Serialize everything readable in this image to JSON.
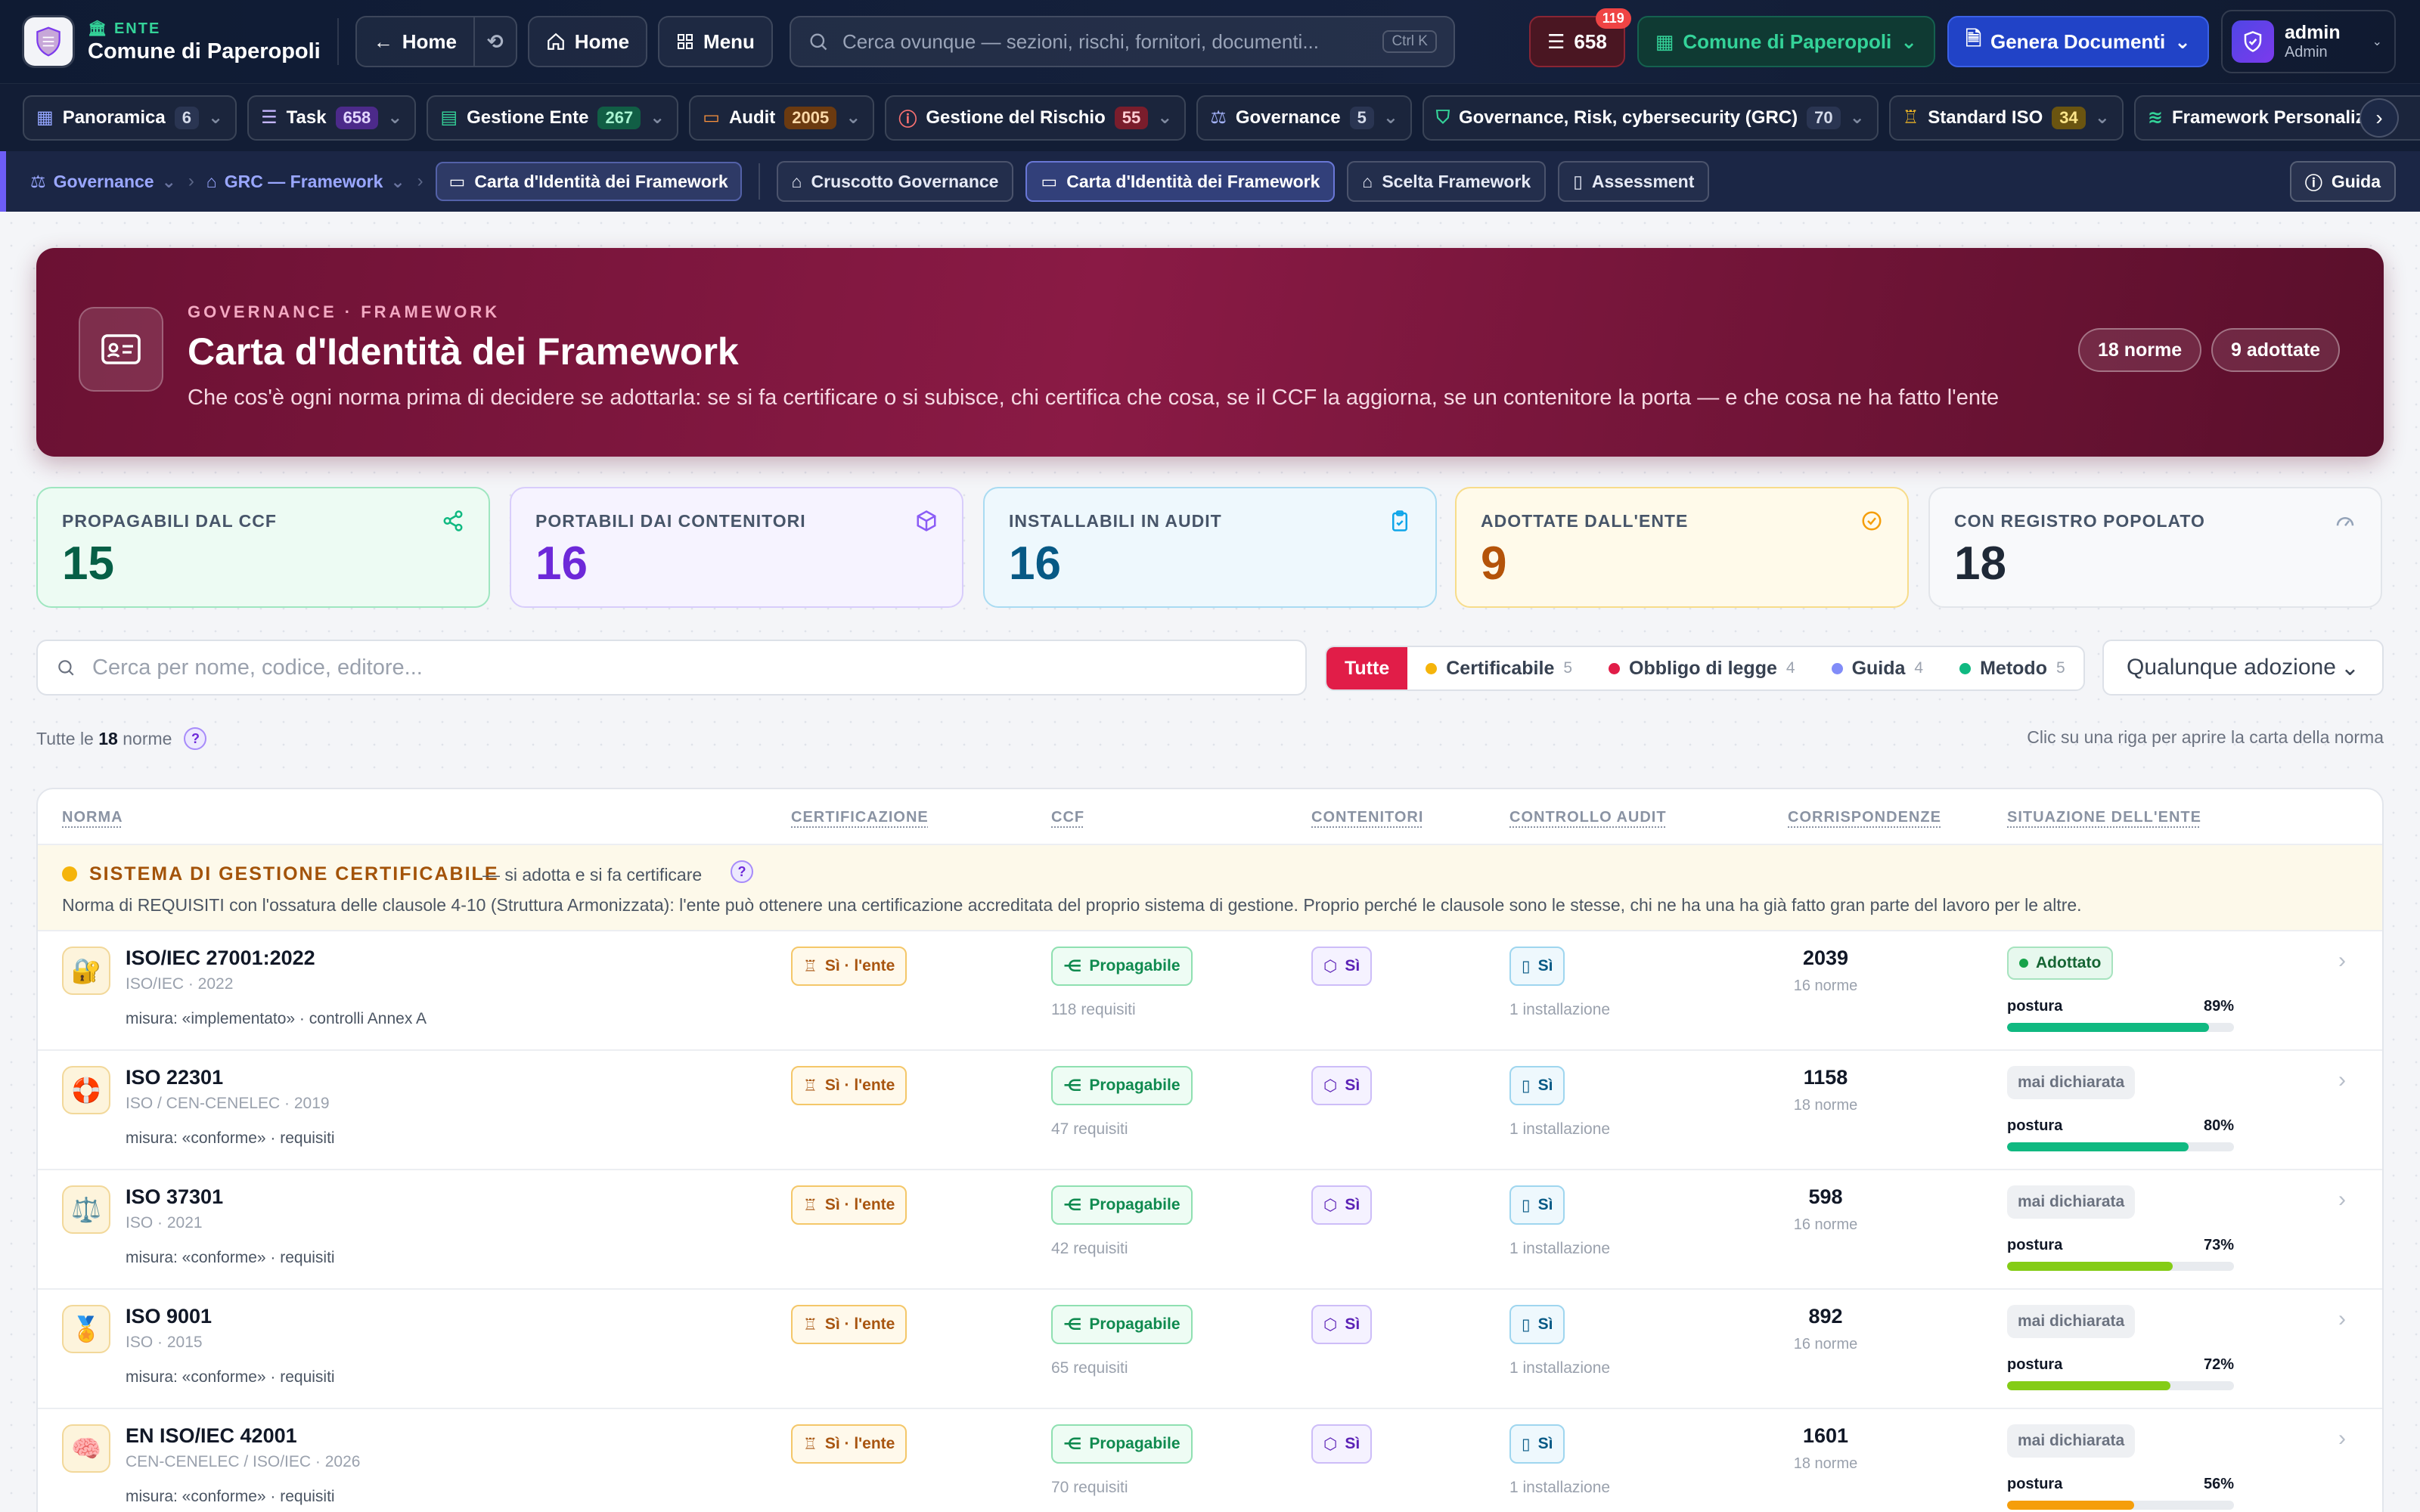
{
  "topbar": {
    "ente_tag": "ENTE",
    "ente_name": "Comune di Paperopoli",
    "back_label": "Home",
    "home_label": "Home",
    "menu_label": "Menu",
    "search_placeholder": "Cerca ovunque — sezioni, rischi, fornitori, documenti...",
    "search_shortcut": "Ctrl K",
    "task_count": "658",
    "task_notifications": "119",
    "ente_select": "Comune di Paperopoli",
    "generate_label": "Genera Documenti",
    "user_name": "admin",
    "user_role": "Admin"
  },
  "modules": [
    {
      "label": "Panoramica",
      "count": "6",
      "icon": "grid-icon"
    },
    {
      "label": "Task",
      "count": "658",
      "icon": "checklist-icon"
    },
    {
      "label": "Gestione Ente",
      "count": "267",
      "icon": "building-icon"
    },
    {
      "label": "Audit",
      "count": "2005",
      "icon": "folder-icon"
    },
    {
      "label": "Gestione del Rischio",
      "count": "55",
      "icon": "alert-icon"
    },
    {
      "label": "Governance",
      "count": "5",
      "icon": "scale-icon"
    },
    {
      "label": "Governance, Risk, cybersecurity (GRC)",
      "count": "70",
      "icon": "shield-icon"
    },
    {
      "label": "Standard ISO",
      "count": "34",
      "icon": "award-icon"
    },
    {
      "label": "Framework Personalizzati",
      "count": "",
      "icon": "layers-icon"
    }
  ],
  "breadcrumb": {
    "level1": "Governance",
    "level2": "GRC — Framework",
    "current": "Carta d'Identità dei Framework",
    "tabs": [
      "Cruscotto Governance",
      "Carta d'Identità dei Framework",
      "Scelta Framework",
      "Assessment"
    ],
    "guide_label": "Guida"
  },
  "hero": {
    "kicker": "GOVERNANCE · FRAMEWORK",
    "title": "Carta d'Identità dei Framework",
    "subtitle": "Che cos'è ogni norma prima di decidere se adottarla: se si fa certificare o si subisce, chi certifica che cosa, se il CCF la aggiorna, se un contenitore la porta — e che cosa ne ha fatto l'ente",
    "pill_norms": "18 norme",
    "pill_adopted": "9 adottate"
  },
  "stats": [
    {
      "label": "PROPAGABILI DAL CCF",
      "value": "15"
    },
    {
      "label": "PORTABILI DAI CONTENITORI",
      "value": "16"
    },
    {
      "label": "INSTALLABILI IN AUDIT",
      "value": "16"
    },
    {
      "label": "ADOTTATE DALL'ENTE",
      "value": "9"
    },
    {
      "label": "CON REGISTRO POPOLATO",
      "value": "18"
    }
  ],
  "filters": {
    "search_placeholder": "Cerca per nome, codice, editore...",
    "chips": [
      {
        "label": "Tutte",
        "count": ""
      },
      {
        "label": "Certificabile",
        "count": "5",
        "color": "#f5b40b"
      },
      {
        "label": "Obbligo di legge",
        "count": "4",
        "color": "#e11d48"
      },
      {
        "label": "Guida",
        "count": "4",
        "color": "#818cf8"
      },
      {
        "label": "Metodo",
        "count": "5",
        "color": "#10b981"
      }
    ],
    "adoption_select": "Qualunque adozione"
  },
  "summary": {
    "prefix": "Tutte le",
    "count": "18",
    "suffix": "norme",
    "hint": "Clic su una riga per aprire la carta della norma"
  },
  "table": {
    "headers": [
      "NORMA",
      "CERTIFICAZIONE",
      "CCF",
      "CONTENITORI",
      "CONTROLLO AUDIT",
      "CORRISPONDENZE",
      "SITUAZIONE DELL'ENTE"
    ],
    "group": {
      "title": "SISTEMA DI GESTIONE CERTIFICABILE",
      "tag": "— si adotta e si fa certificare",
      "description": "Norma di REQUISITI con l'ossatura delle clausole 4-10 (Struttura Armonizzata): l'ente può ottenere una certificazione accreditata del proprio sistema di gestione. Proprio perché le clausole sono le stesse, chi ne ha una ha già fatto gran parte del lavoro per le altre."
    },
    "rows": [
      {
        "icon": "🔐",
        "name": "ISO/IEC 27001:2022",
        "meta": "ISO/IEC · 2022",
        "measure": "misura: «implementato» · controlli Annex A",
        "cert": "Sì · l'ente",
        "ccf": "Propagabile",
        "ccf_sub": "118 requisiti",
        "cont": "Sì",
        "audit": "Sì",
        "audit_sub": "1 installazione",
        "corr": "2039",
        "corr_sub": "16 norme",
        "status": "Adottato",
        "posture_label": "postura",
        "posture": "89%",
        "posture_value": 89,
        "bar_color": "#10b981"
      },
      {
        "icon": "🛟",
        "name": "ISO 22301",
        "meta": "ISO / CEN-CENELEC · 2019",
        "measure": "misura: «conforme» · requisiti",
        "cert": "Sì · l'ente",
        "ccf": "Propagabile",
        "ccf_sub": "47 requisiti",
        "cont": "Sì",
        "audit": "Sì",
        "audit_sub": "1 installazione",
        "corr": "1158",
        "corr_sub": "18 norme",
        "status": "mai dichiarata",
        "posture_label": "postura",
        "posture": "80%",
        "posture_value": 80,
        "bar_color": "#10b981"
      },
      {
        "icon": "⚖️",
        "name": "ISO 37301",
        "meta": "ISO · 2021",
        "measure": "misura: «conforme» · requisiti",
        "cert": "Sì · l'ente",
        "ccf": "Propagabile",
        "ccf_sub": "42 requisiti",
        "cont": "Sì",
        "audit": "Sì",
        "audit_sub": "1 installazione",
        "corr": "598",
        "corr_sub": "16 norme",
        "status": "mai dichiarata",
        "posture_label": "postura",
        "posture": "73%",
        "posture_value": 73,
        "bar_color": "#84cc16"
      },
      {
        "icon": "🏅",
        "name": "ISO 9001",
        "meta": "ISO · 2015",
        "measure": "misura: «conforme» · requisiti",
        "cert": "Sì · l'ente",
        "ccf": "Propagabile",
        "ccf_sub": "65 requisiti",
        "cont": "Sì",
        "audit": "Sì",
        "audit_sub": "1 installazione",
        "corr": "892",
        "corr_sub": "16 norme",
        "status": "mai dichiarata",
        "posture_label": "postura",
        "posture": "72%",
        "posture_value": 72,
        "bar_color": "#84cc16"
      },
      {
        "icon": "🧠",
        "name": "EN ISO/IEC 42001",
        "meta": "CEN-CENELEC / ISO/IEC · 2026",
        "measure": "misura: «conforme» · requisiti",
        "cert": "Sì · l'ente",
        "ccf": "Propagabile",
        "ccf_sub": "70 requisiti",
        "cont": "Sì",
        "audit": "Sì",
        "audit_sub": "1 installazione",
        "corr": "1601",
        "corr_sub": "18 norme",
        "status": "mai dichiarata",
        "posture_label": "postura",
        "posture": "56%",
        "posture_value": 56,
        "bar_color": "#f59e0b"
      }
    ]
  }
}
